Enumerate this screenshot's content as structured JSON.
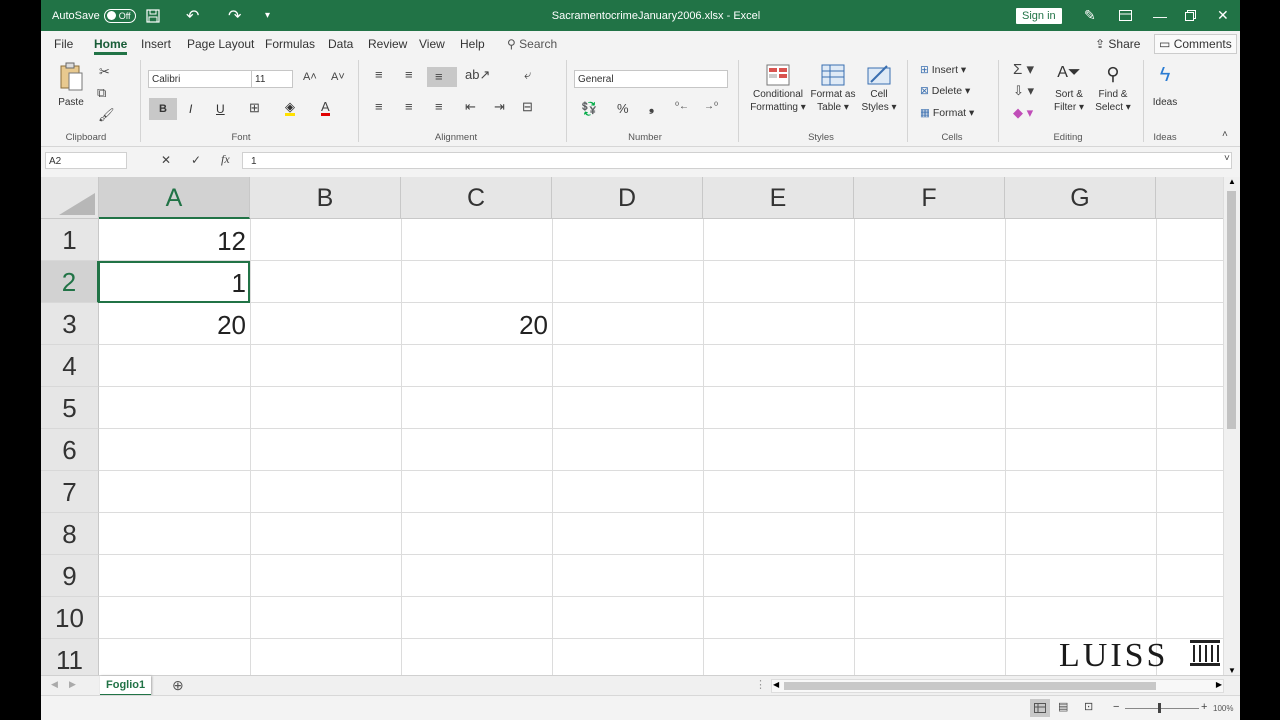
{
  "titlebar": {
    "autosave_label": "AutoSave",
    "autosave_state": "Off",
    "title": "SacramentocrimeJanuary2006.xlsx  -  Excel",
    "signin": "Sign in",
    "icons": [
      "save-icon",
      "undo-icon",
      "redo-icon",
      "customize-icon",
      "pen-icon",
      "ribbon-display-icon",
      "minimize-icon",
      "restore-icon",
      "close-icon"
    ]
  },
  "tabs": [
    "File",
    "Home",
    "Insert",
    "Page Layout",
    "Formulas",
    "Data",
    "Review",
    "View",
    "Help"
  ],
  "active_tab": "Home",
  "search_label": "Search",
  "share_label": "Share",
  "comments_label": "Comments",
  "ribbon": {
    "clipboard": {
      "paste": "Paste",
      "label": "Clipboard"
    },
    "font": {
      "name": "Calibri",
      "size": "11",
      "label": "Font",
      "bold": "B",
      "italic": "I",
      "underline": "U"
    },
    "alignment": {
      "label": "Alignment"
    },
    "number": {
      "format": "General",
      "label": "Number"
    },
    "styles": {
      "conditional": [
        "Conditional",
        "Formatting"
      ],
      "format_table": [
        "Format as",
        "Table"
      ],
      "cell_styles": [
        "Cell",
        "Styles"
      ],
      "label": "Styles"
    },
    "cells": {
      "insert": "Insert",
      "delete": "Delete",
      "format": "Format",
      "label": "Cells"
    },
    "editing": {
      "sort": [
        "Sort &",
        "Filter"
      ],
      "find": [
        "Find &",
        "Select"
      ],
      "label": "Editing"
    },
    "ideas": {
      "button": "Ideas",
      "label": "Ideas"
    }
  },
  "formula_bar": {
    "name_box": "A2",
    "fx": "fx",
    "value": "1"
  },
  "grid": {
    "columns": [
      "A",
      "B",
      "C",
      "D",
      "E",
      "F",
      "G"
    ],
    "rows": [
      "1",
      "2",
      "3",
      "4",
      "5",
      "6",
      "7",
      "8",
      "9",
      "10",
      "11"
    ],
    "selected_cell": "A2",
    "cells": {
      "A1": "12",
      "A2": "1",
      "A3": "20",
      "C3": "20"
    }
  },
  "sheets": [
    "Foglio1"
  ],
  "status": {
    "zoom": "100%"
  },
  "watermark": "LUISS"
}
